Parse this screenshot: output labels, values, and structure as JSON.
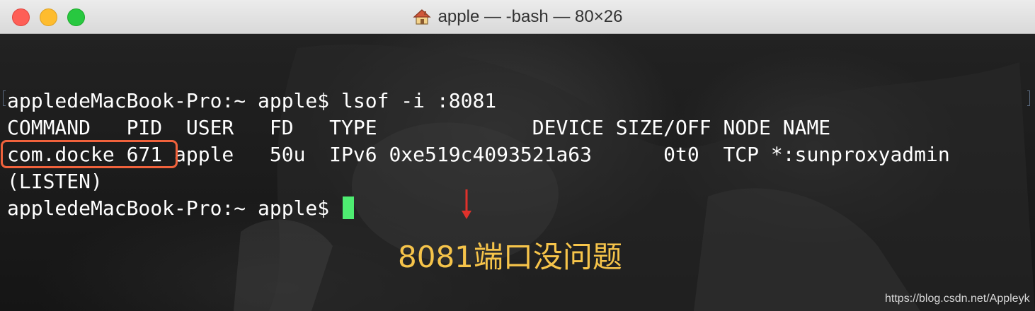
{
  "window": {
    "title": "apple — -bash — 80×26"
  },
  "terminal": {
    "lines": [
      "appledeMacBook-Pro:~ apple$ lsof -i :8081",
      "COMMAND   PID  USER   FD   TYPE             DEVICE SIZE/OFF NODE NAME",
      "com.docke 671 apple   50u  IPv6 0xe519c4093521a63      0t0  TCP *:sunproxyadmin",
      "(LISTEN)"
    ],
    "prompt": "appledeMacBook-Pro:~ apple$ "
  },
  "annotation": {
    "text": "8081端口没问题"
  },
  "watermark": {
    "text": "https://blog.csdn.net/Appleyk"
  },
  "colors": {
    "cursor": "#4eec71",
    "highlight_box": "#f0623c",
    "annotation": "#f6c44a",
    "arrow": "#e0312b"
  }
}
